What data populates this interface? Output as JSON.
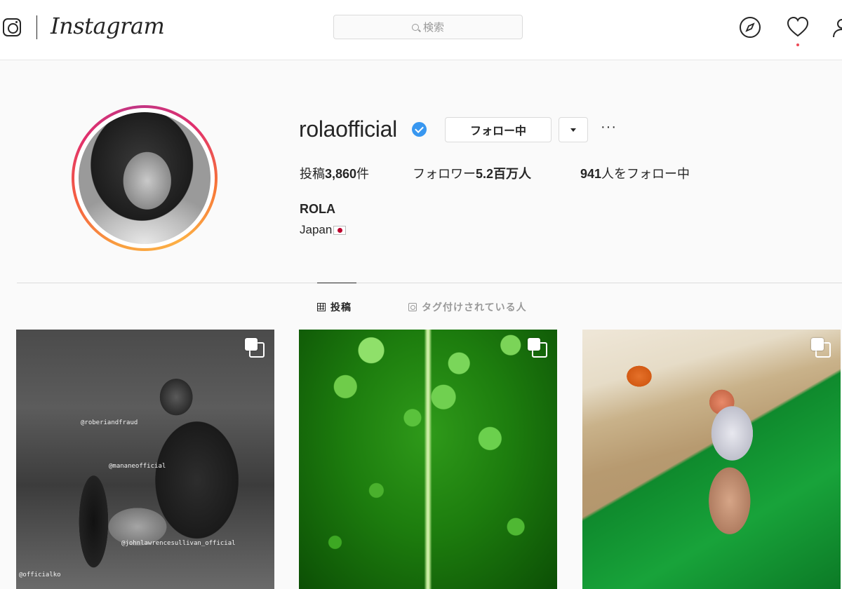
{
  "header": {
    "wordmark": "Instagram",
    "search_placeholder": "検索"
  },
  "profile": {
    "username": "rolaofficial",
    "follow_button_label": "フォロー中",
    "more_label": "···",
    "stats": {
      "posts_label": "投稿",
      "posts_value": "3,860",
      "posts_suffix": "件",
      "followers_label": "フォロワー",
      "followers_value": "5.2百万人",
      "following_value": "941",
      "following_suffix": "人をフォロー中"
    },
    "full_name": "ROLA",
    "bio": "Japan"
  },
  "tabs": [
    {
      "label": "投稿"
    },
    {
      "label": "タグ付けされている人"
    }
  ],
  "posts": [
    {
      "tags": [
        "@roberiandfraud",
        "@mananeofficial",
        "@johnlawrencesullivan_official",
        "@officialko"
      ]
    },
    {
      "tags": []
    },
    {
      "tags": []
    }
  ],
  "colors": {
    "verified": "#3897f0",
    "text": "#262626",
    "muted": "#999999",
    "border": "#dbdbdb",
    "background": "#fafafa"
  },
  "icons": [
    "instagram-glyph-icon",
    "search-icon",
    "explore-compass-icon",
    "heart-icon",
    "user-icon",
    "verified-badge-icon",
    "caret-down-icon",
    "grid-icon",
    "tag-person-icon",
    "multiple-photos-icon",
    "japan-flag-icon"
  ]
}
